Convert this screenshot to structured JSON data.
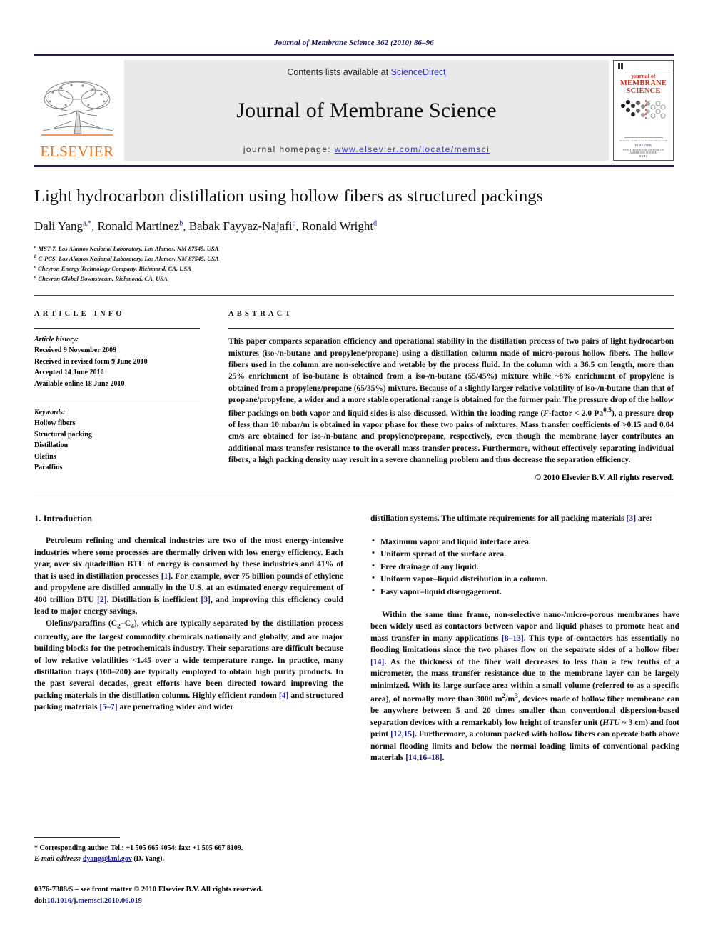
{
  "running_head": "Journal of Membrane Science 362 (2010) 86–96",
  "masthead": {
    "contents_prefix": "Contents lists available at ",
    "sciencedirect": "ScienceDirect",
    "journal_title": "Journal of Membrane Science",
    "homepage_prefix": "journal homepage:",
    "homepage_url": "www.elsevier.com/locate/memsci",
    "publisher": "ELSEVIER",
    "cover": {
      "line1": "journal of",
      "line2": "MEMBRANE",
      "line3": "SCIENCE",
      "foot1": "AN INTERNATIONAL JOURNAL ON MEMBRANE SCIENCE",
      "foot2": "ELSEVIER",
      "foot3": "Available online at www.sciencedirect.com",
      "foot4": "1 1 8 1"
    },
    "accent_blue": "#3b3bbd",
    "accent_orange": "#e87722",
    "cover_red": "#c0392b",
    "panel_gray": "#e9e9e9"
  },
  "title": "Light hydrocarbon distillation using hollow fibers as structured packings",
  "authors": [
    {
      "name": "Dali Yang",
      "marks": "a,*"
    },
    {
      "name": "Ronald Martinez",
      "marks": "b"
    },
    {
      "name": "Babak Fayyaz-Najafi",
      "marks": "c"
    },
    {
      "name": "Ronald Wright",
      "marks": "d"
    }
  ],
  "affiliations": [
    {
      "mark": "a",
      "text": "MST-7, Los Alamos National Laboratory, Los Alamos, NM 87545, USA"
    },
    {
      "mark": "b",
      "text": "C-PCS, Los Alamos National Laboratory, Los Alamos, NM 87545, USA"
    },
    {
      "mark": "c",
      "text": "Chevron Energy Technology Company, Richmond, CA, USA"
    },
    {
      "mark": "d",
      "text": "Chevron Global Downstream, Richmond, CA, USA"
    }
  ],
  "article_info": {
    "heading": "ARTICLE INFO",
    "history_title": "Article history:",
    "history": [
      "Received 9 November 2009",
      "Received in revised form 9 June 2010",
      "Accepted 14 June 2010",
      "Available online 18 June 2010"
    ],
    "keywords_title": "Keywords:",
    "keywords": [
      "Hollow fibers",
      "Structural packing",
      "Distillation",
      "Olefins",
      "Paraffins"
    ]
  },
  "abstract": {
    "heading": "ABSTRACT",
    "text": "This paper compares separation efficiency and operational stability in the distillation process of two pairs of light hydrocarbon mixtures (iso-/n-butane and propylene/propane) using a distillation column made of micro-porous hollow fibers. The hollow fibers used in the column are non-selective and wetable by the process fluid. In the column with a 36.5 cm length, more than 25% enrichment of iso-butane is obtained from a iso-/n-butane (55/45%) mixture while ~8% enrichment of propylene is obtained from a propylene/propane (65/35%) mixture. Because of a slightly larger relative volatility of iso-/n-butane than that of propane/propylene, a wider and a more stable operational range is obtained for the former pair. The pressure drop of the hollow fiber packings on both vapor and liquid sides is also discussed. Within the loading range (F-factor < 2.0 Pa0.5), a pressure drop of less than 10 mbar/m is obtained in vapor phase for these two pairs of mixtures. Mass transfer coefficients of >0.15 and 0.04 cm/s are obtained for iso-/n-butane and propylene/propane, respectively, even though the membrane layer contributes an additional mass transfer resistance to the overall mass transfer process. Furthermore, without effectively separating individual fibers, a high packing density may result in a severe channeling problem and thus decrease the separation efficiency.",
    "copyright": "© 2010 Elsevier B.V. All rights reserved."
  },
  "body": {
    "section_heading": "1. Introduction",
    "left_p1": "Petroleum refining and chemical industries are two of the most energy-intensive industries where some processes are thermally driven with low energy efficiency. Each year, over six quadrillion BTU of energy is consumed by these industries and 41% of that is used in distillation processes [1]. For example, over 75 billion pounds of ethylene and propylene are distilled annually in the U.S. at an estimated energy requirement of 400 trillion BTU [2]. Distillation is inefficient [3], and improving this efficiency could lead to major energy savings.",
    "left_p2": "Olefins/paraffins (C2–C4), which are typically separated by the distillation process currently, are the largest commodity chemicals nationally and globally, and are major building blocks for the petrochemicals industry. Their separations are difficult because of low relative volatilities <1.45 over a wide temperature range. In practice, many distillation trays (100–200) are typically employed to obtain high purity products. In the past several decades, great efforts have been directed toward improving the packing materials in the distillation column. Highly efficient random [4] and structured packing materials [5–7] are penetrating wider and wider",
    "right_p1": "distillation systems. The ultimate requirements for all packing materials [3] are:",
    "bullets": [
      "Maximum vapor and liquid interface area.",
      "Uniform spread of the surface area.",
      "Free drainage of any liquid.",
      "Uniform vapor–liquid distribution in a column.",
      "Easy vapor–liquid disengagement."
    ],
    "right_p2": "Within the same time frame, non-selective nano-/micro-porous membranes have been widely used as contactors between vapor and liquid phases to promote heat and mass transfer in many applications [8–13]. This type of contactors has essentially no flooding limitations since the two phases flow on the separate sides of a hollow fiber [14]. As the thickness of the fiber wall decreases to less than a few tenths of a micrometer, the mass transfer resistance due to the membrane layer can be largely minimized. With its large surface area within a small volume (referred to as a specific area), of normally more than 3000 m2/m3, devices made of hollow fiber membrane can be anywhere between 5 and 20 times smaller than conventional dispersion-based separation devices with a remarkably low height of transfer unit (HTU ~ 3 cm) and foot print [12,15]. Furthermore, a column packed with hollow fibers can operate both above normal flooding limits and below the normal loading limits of conventional packing materials [14,16–18]."
  },
  "footnote": {
    "corresponding": "* Corresponding author. Tel.: +1 505 665 4054; fax: +1 505 667 8109.",
    "email_label": "E-mail address:",
    "email": "dyang@lanl.gov",
    "email_suffix": "(D. Yang).",
    "issn_line": "0376-7388/$ – see front matter © 2010 Elsevier B.V. All rights reserved.",
    "doi_label": "doi:",
    "doi": "10.1016/j.memsci.2010.06.019"
  }
}
